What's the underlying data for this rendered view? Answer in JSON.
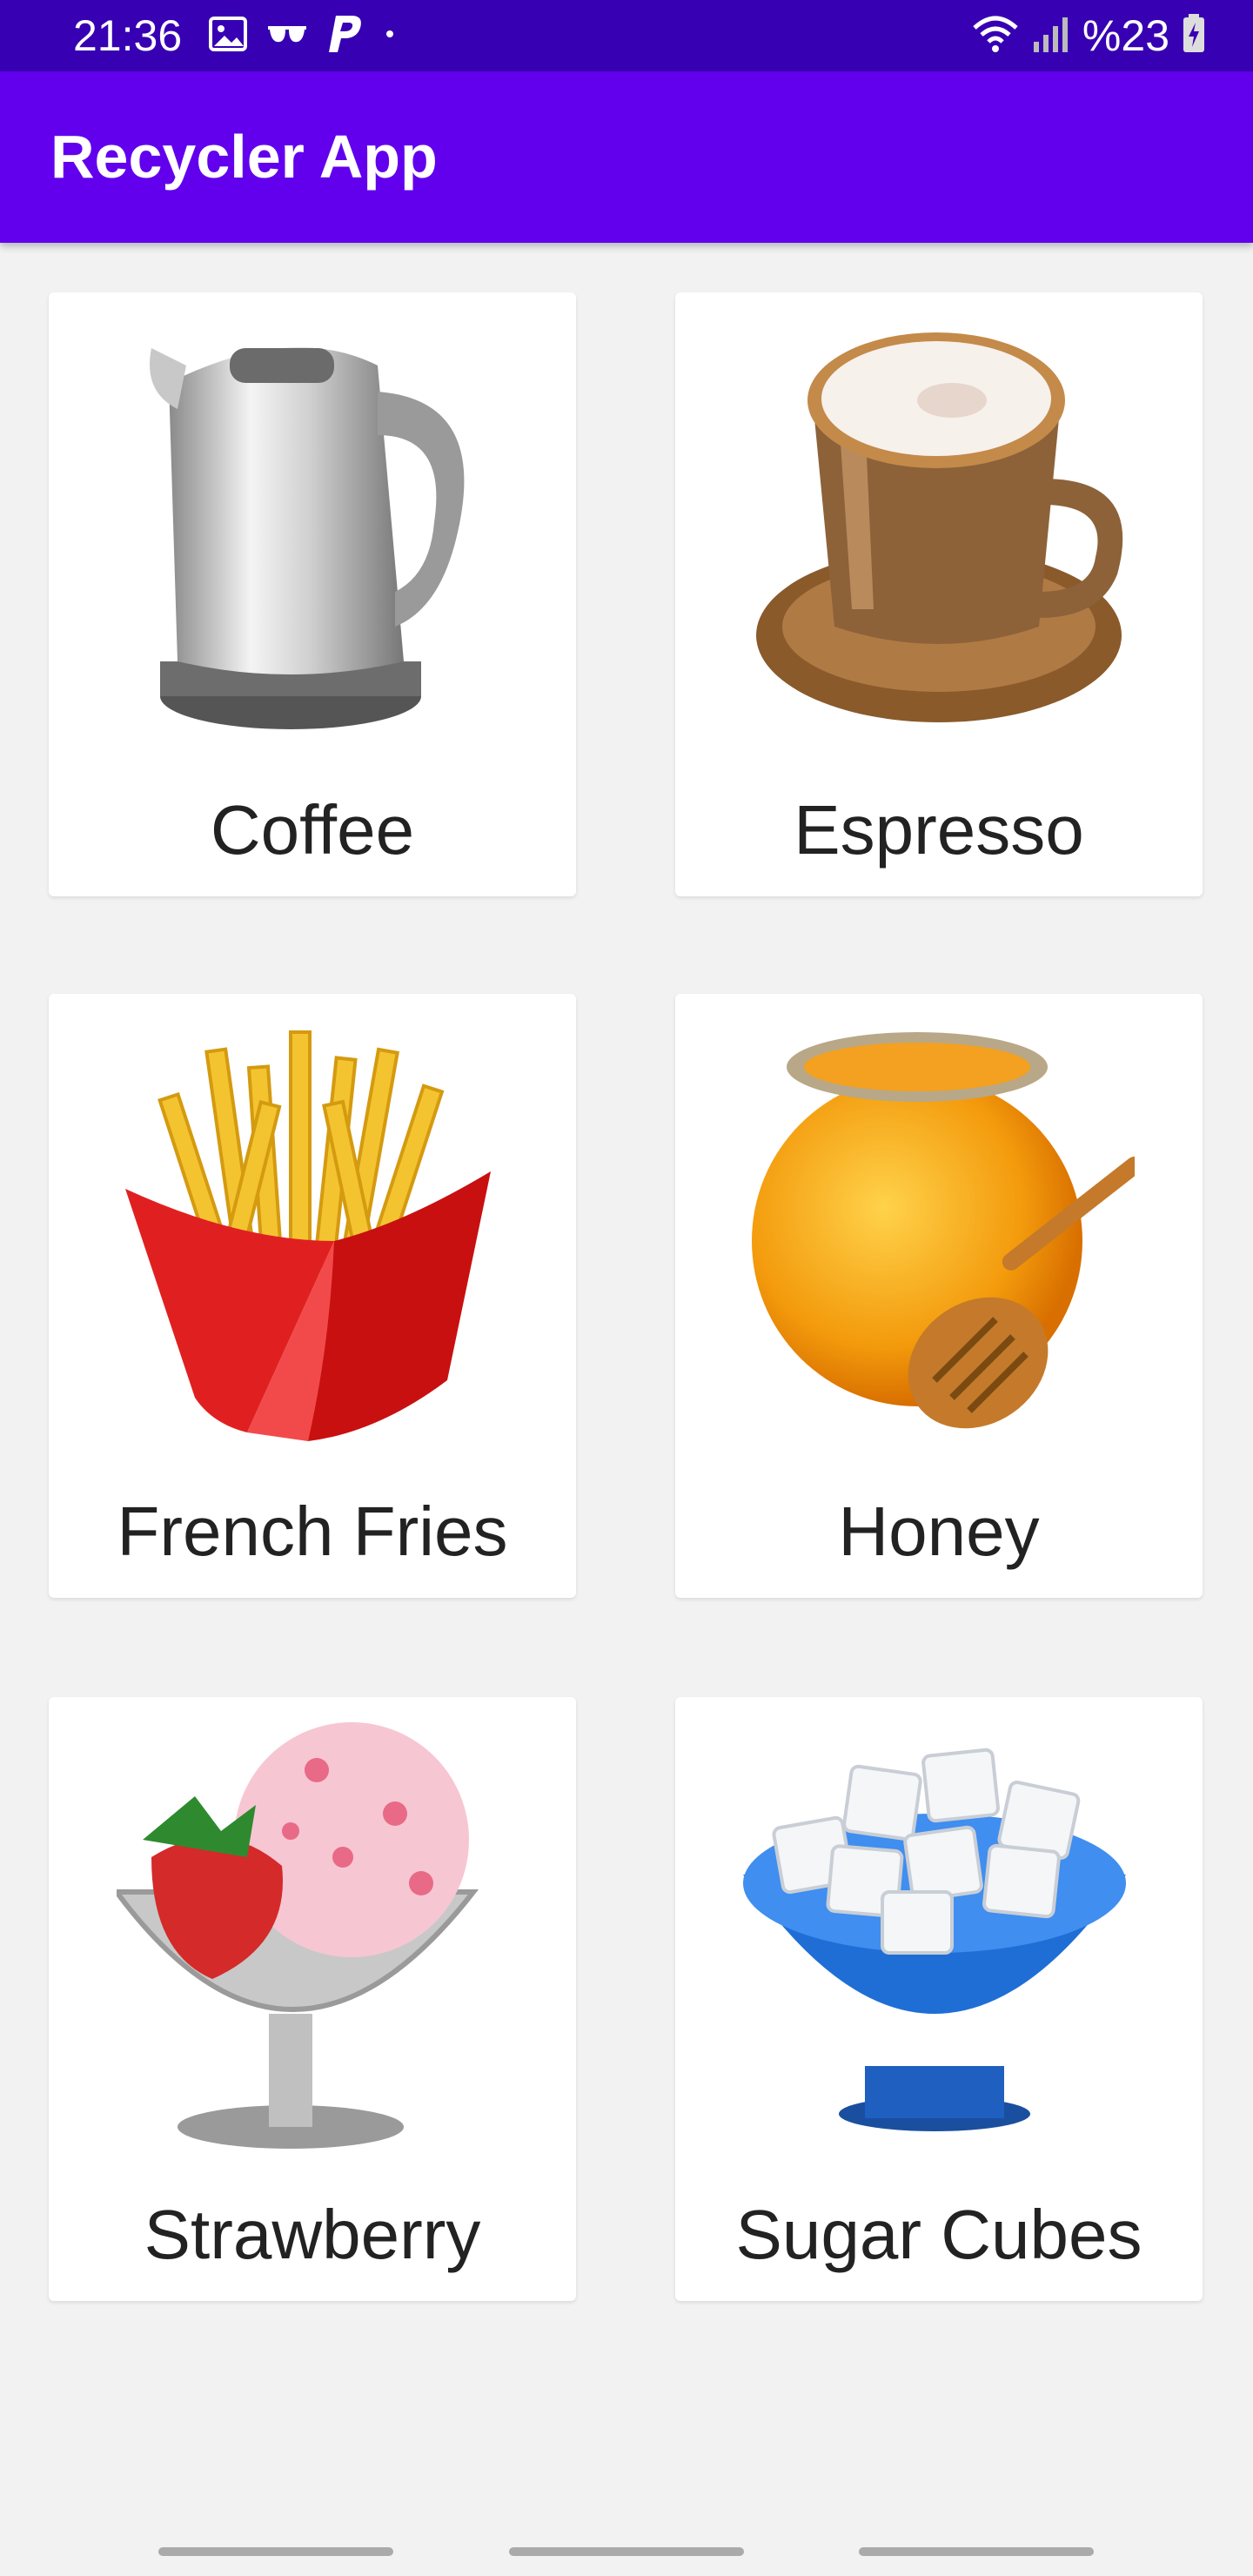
{
  "status_bar": {
    "time": "21:36",
    "battery_text": "%23",
    "left_icons": [
      "gallery-icon",
      "sunglasses-icon",
      "paypal-icon",
      "dot-icon"
    ],
    "right_icons": [
      "wifi-icon",
      "signal-icon",
      "battery-icon"
    ]
  },
  "app_bar": {
    "title": "Recycler App"
  },
  "items": [
    {
      "label": "Coffee",
      "icon": "kettle-icon"
    },
    {
      "label": "Espresso",
      "icon": "espresso-cup-icon"
    },
    {
      "label": "French Fries",
      "icon": "french-fries-icon"
    },
    {
      "label": "Honey",
      "icon": "honey-pot-icon"
    },
    {
      "label": "Strawberry",
      "icon": "strawberry-ice-cream-icon"
    },
    {
      "label": "Sugar Cubes",
      "icon": "sugar-bowl-icon"
    }
  ],
  "colors": {
    "status_bar": "#3700b3",
    "app_bar": "#6200ee",
    "background": "#f2f2f2",
    "card": "#ffffff"
  }
}
